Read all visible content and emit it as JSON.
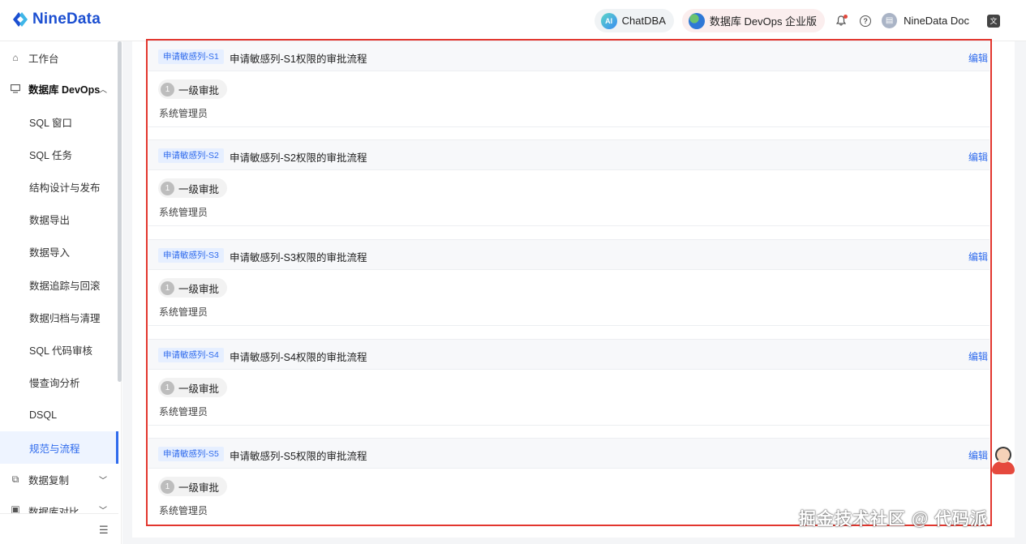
{
  "header": {
    "brand": "NineData",
    "chatdba_label": "ChatDBA",
    "ai_badge": "AI",
    "devops_label": "数据库 DevOps 企业版",
    "user_name": "NineData Doc",
    "brand_color": "#1c4fd1"
  },
  "sidebar": {
    "items": [
      {
        "label": "工作台",
        "icon": "home-icon"
      },
      {
        "label": "数据库 DevOps",
        "icon": "monitor-icon",
        "expanded": true
      },
      {
        "label": "SQL 窗口"
      },
      {
        "label": "SQL 任务"
      },
      {
        "label": "结构设计与发布"
      },
      {
        "label": "数据导出"
      },
      {
        "label": "数据导入"
      },
      {
        "label": "数据追踪与回滚"
      },
      {
        "label": "数据归档与清理"
      },
      {
        "label": "SQL 代码审核"
      },
      {
        "label": "慢查询分析"
      },
      {
        "label": "DSQL"
      },
      {
        "label": "规范与流程",
        "active": true
      },
      {
        "label": "数据复制",
        "icon": "copy-icon"
      },
      {
        "label": "数据库对比",
        "icon": "compare-icon"
      }
    ]
  },
  "cards": [
    {
      "tag": "申请敏感列-S1",
      "title": "申请敏感列-S1权限的审批流程",
      "edit": "编辑",
      "step_num": "1",
      "step_label": "一级审批",
      "approver": "系统管理员"
    },
    {
      "tag": "申请敏感列-S2",
      "title": "申请敏感列-S2权限的审批流程",
      "edit": "编辑",
      "step_num": "1",
      "step_label": "一级审批",
      "approver": "系统管理员"
    },
    {
      "tag": "申请敏感列-S3",
      "title": "申请敏感列-S3权限的审批流程",
      "edit": "编辑",
      "step_num": "1",
      "step_label": "一级审批",
      "approver": "系统管理员"
    },
    {
      "tag": "申请敏感列-S4",
      "title": "申请敏感列-S4权限的审批流程",
      "edit": "编辑",
      "step_num": "1",
      "step_label": "一级审批",
      "approver": "系统管理员"
    },
    {
      "tag": "申请敏感列-S5",
      "title": "申请敏感列-S5权限的审批流程",
      "edit": "编辑",
      "step_num": "1",
      "step_label": "一级审批",
      "approver": "系统管理员"
    }
  ],
  "watermark": "掘金技术社区 @ 代码派",
  "colors": {
    "accent": "#2f6bed",
    "highlight_border": "#e2362e"
  }
}
